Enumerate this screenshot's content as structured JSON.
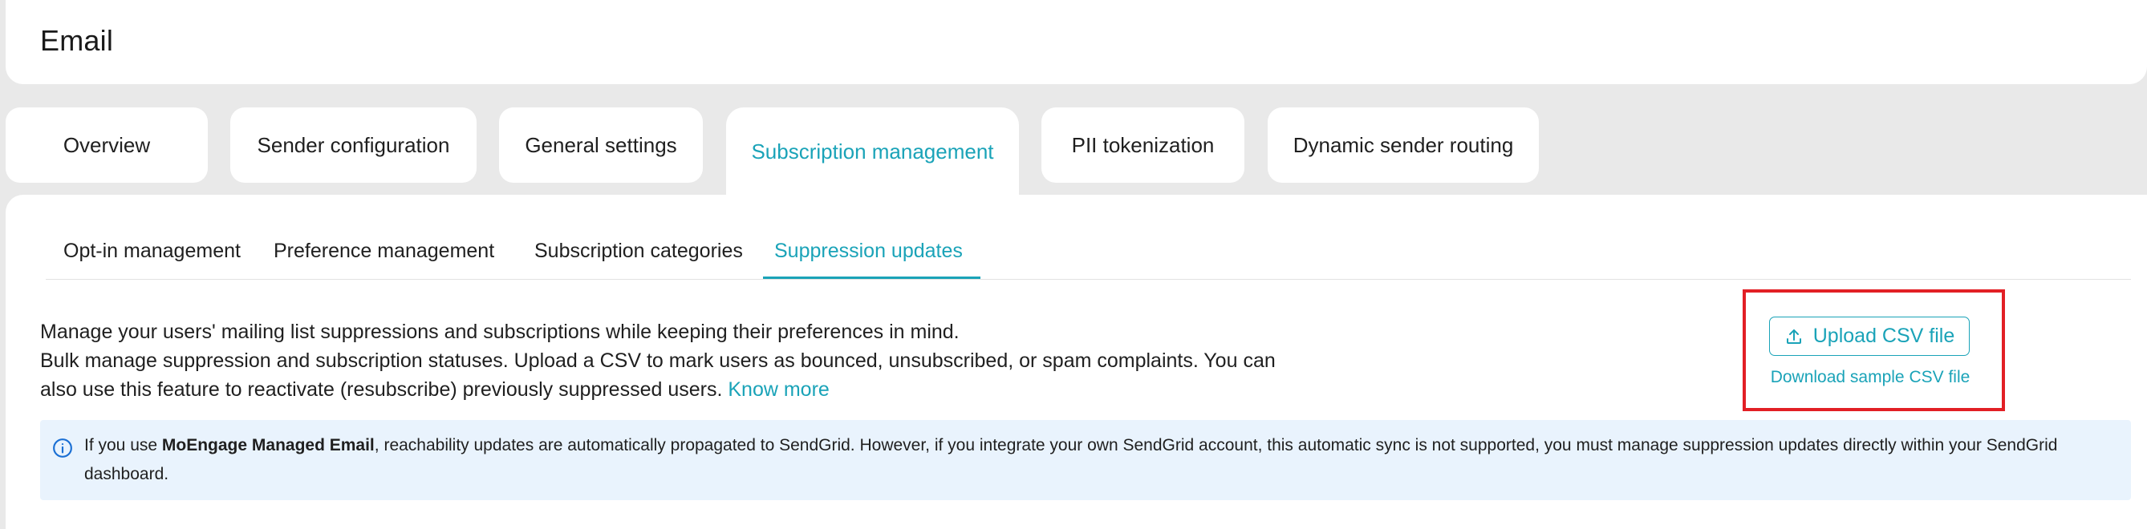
{
  "header": {
    "title": "Email"
  },
  "tabs": [
    {
      "label": "Overview"
    },
    {
      "label": "Sender configuration"
    },
    {
      "label": "General settings"
    },
    {
      "label": "Subscription management",
      "active": true
    },
    {
      "label": "PII tokenization"
    },
    {
      "label": "Dynamic sender routing"
    }
  ],
  "subtabs": [
    {
      "label": "Opt-in management"
    },
    {
      "label": "Preference management"
    },
    {
      "label": "Subscription categories"
    },
    {
      "label": "Suppression updates",
      "active": true
    }
  ],
  "description": {
    "line1": "Manage your users' mailing list suppressions and subscriptions while keeping their preferences in mind.",
    "line2": "Bulk manage suppression and subscription statuses. Upload a CSV to mark users as bounced, unsubscribed, or spam complaints. You can",
    "line3": "also use this feature to reactivate (resubscribe) previously suppressed users.",
    "know_more": "Know more"
  },
  "actions": {
    "upload_label": "Upload CSV file",
    "upload_icon": "upload-icon",
    "download_label": "Download sample CSV file"
  },
  "info": {
    "icon": "info-icon",
    "prefix": "If you use ",
    "bold": "MoEngage Managed Email",
    "suffix": ", reachability updates are automatically propagated to SendGrid. However, if you integrate your own SendGrid account, this automatic sync is not supported, you must manage suppression updates directly within your SendGrid dashboard."
  },
  "colors": {
    "accent": "#1aa3b8",
    "highlight_border": "#e21f25",
    "info_background": "#e9f3fd",
    "page_background": "#e9e9e9"
  }
}
